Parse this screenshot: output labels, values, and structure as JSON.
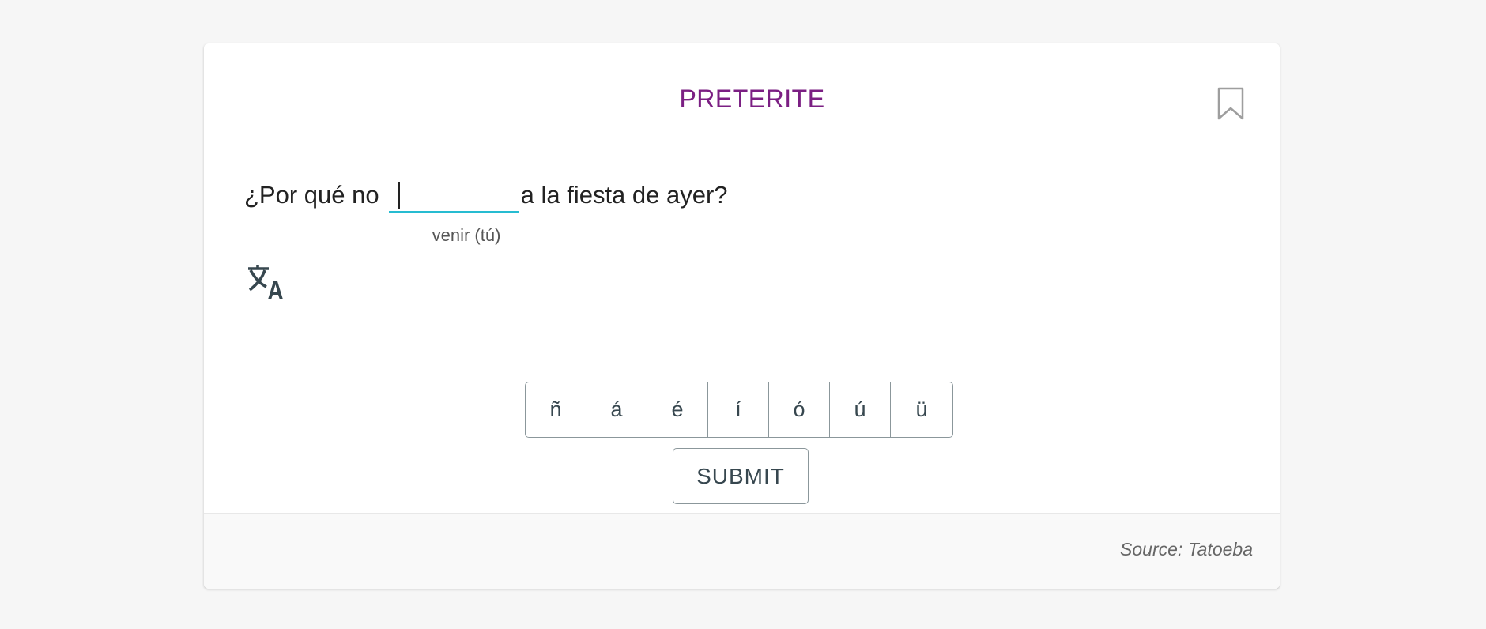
{
  "card": {
    "tense": "PRETERITE",
    "bookmark_icon": "bookmark-outline-icon",
    "sentence": {
      "before": "¿Por qué no",
      "after": "a la fiesta de ayer?",
      "answer_value": "",
      "hint": "venir (tú)"
    },
    "translate_icon": "translate-icon",
    "accent_keys": [
      "ñ",
      "á",
      "é",
      "í",
      "ó",
      "ú",
      "ü"
    ],
    "submit_label": "SUBMIT",
    "source": "Source: Tatoeba"
  },
  "colors": {
    "tense": "#7b1f83",
    "input_underline": "#26bcd1",
    "button_text": "#37474f",
    "button_border": "#8b979b",
    "page_background": "#f6f6f6"
  }
}
